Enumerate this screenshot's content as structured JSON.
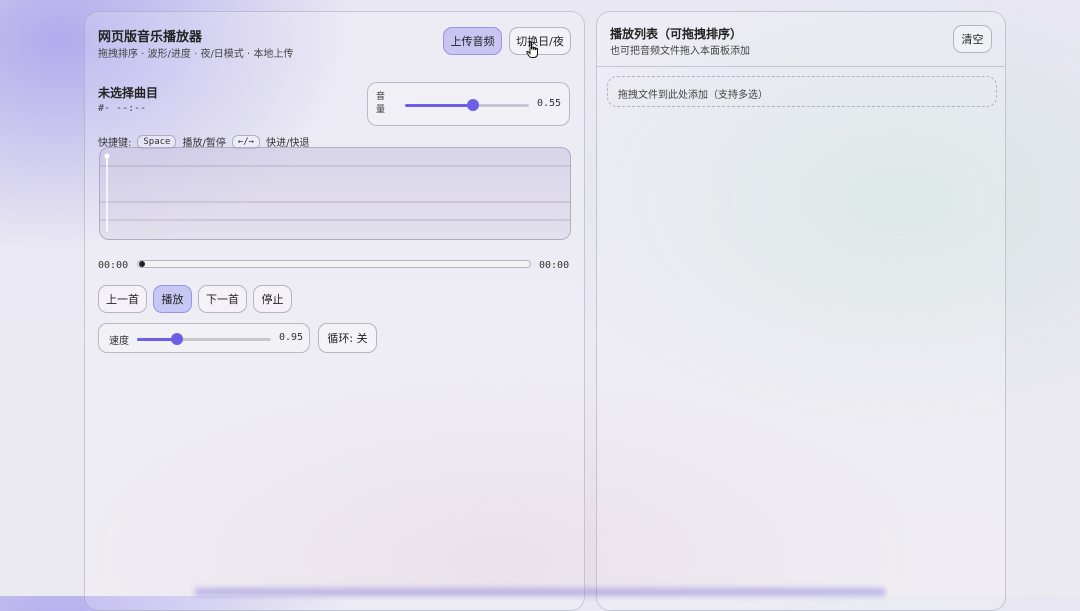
{
  "player": {
    "title": "网页版音乐播放器",
    "subtitle": "拖拽排序 · 波形/进度 · 夜/日模式 · 本地上传",
    "upload_label": "上传音频",
    "theme_toggle_label": "切换日/夜",
    "track": {
      "title": "未选择曲目",
      "meta": "#- --:--"
    },
    "volume": {
      "label": "音量",
      "value": 0.55,
      "value_text": "0.55"
    },
    "shortcuts": {
      "prefix": "快捷键:",
      "play_key": "Space",
      "play_desc": "播放/暂停",
      "seek_key": "←/→",
      "seek_desc": "快进/快退"
    },
    "time_current": "00:00",
    "time_total": "00:00",
    "progress": 0,
    "controls": {
      "prev": "上一首",
      "play": "播放",
      "next": "下一首",
      "stop": "停止"
    },
    "speed": {
      "label": "速度",
      "value": 0.95,
      "value_text": "0.95"
    },
    "loop_label": "循环: 关"
  },
  "playlist": {
    "title": "播放列表（可拖拽排序）",
    "subtitle": "也可把音频文件拖入本面板添加",
    "clear_label": "清空",
    "dropzone_text": "拖拽文件到此处添加（支持多选）"
  },
  "colors": {
    "accent": "#6b5fe8",
    "waveform_line_start": "#6b5fe8",
    "waveform_line_end": "#3fae8a"
  }
}
